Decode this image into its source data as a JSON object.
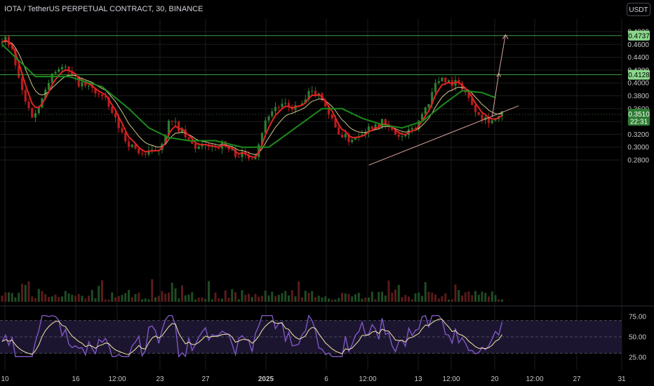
{
  "header": {
    "title": "IOTA / TetherUS PERPETUAL CONTRACT, 30, BINANCE",
    "currency_button": "USDT"
  },
  "colors": {
    "background": "#000000",
    "grid": "#1c1c1c",
    "axis_text": "#c8c8c8",
    "up_candle": "#2e7d32",
    "down_candle": "#b71c1c",
    "ema_red": "#e02424",
    "ema_yellow": "#f3e9a6",
    "ema_green": "#1b8a1b",
    "horizontal_level": "#3f9e3f",
    "label_green": "#8bd88b",
    "trendline": "#d8a49c",
    "rsi_band": "#1c1530",
    "rsi_line": "#7e57c2",
    "rsi_ma": "#f3e9a6"
  },
  "chart_data": {
    "type": "candlestick",
    "price_axis": {
      "ticks": [
        "0.4800",
        "0.4600",
        "0.4400",
        "0.4200",
        "0.4000",
        "0.3800",
        "0.3600",
        "0.3400",
        "0.3200",
        "0.3000",
        "0.2800"
      ],
      "range": [
        0.272,
        0.482
      ]
    },
    "time_axis": {
      "ticks": [
        "10",
        "16",
        "12:00",
        "23",
        "27",
        "2025",
        "6",
        "12:00",
        "13",
        "12:00",
        "20",
        "12:00",
        "27",
        "31"
      ]
    },
    "price_path": [
      [
        0,
        0.462
      ],
      [
        1,
        0.468
      ],
      [
        3,
        0.45
      ],
      [
        5,
        0.405
      ],
      [
        7,
        0.37
      ],
      [
        9,
        0.35
      ],
      [
        11,
        0.36
      ],
      [
        13,
        0.395
      ],
      [
        15,
        0.415
      ],
      [
        17,
        0.425
      ],
      [
        19,
        0.422
      ],
      [
        21,
        0.41
      ],
      [
        23,
        0.4
      ],
      [
        25,
        0.395
      ],
      [
        27,
        0.39
      ],
      [
        29,
        0.382
      ],
      [
        31,
        0.372
      ],
      [
        33,
        0.352
      ],
      [
        35,
        0.332
      ],
      [
        37,
        0.312
      ],
      [
        39,
        0.3
      ],
      [
        41,
        0.293
      ],
      [
        43,
        0.288
      ],
      [
        45,
        0.292
      ],
      [
        47,
        0.298
      ],
      [
        49,
        0.322
      ],
      [
        50,
        0.338
      ],
      [
        52,
        0.335
      ],
      [
        54,
        0.322
      ],
      [
        56,
        0.308
      ],
      [
        58,
        0.3
      ],
      [
        60,
        0.298
      ],
      [
        62,
        0.305
      ],
      [
        64,
        0.3
      ],
      [
        66,
        0.305
      ],
      [
        68,
        0.296
      ],
      [
        70,
        0.29
      ],
      [
        72,
        0.288
      ],
      [
        74,
        0.285
      ],
      [
        76,
        0.29
      ],
      [
        78,
        0.325
      ],
      [
        80,
        0.352
      ],
      [
        82,
        0.362
      ],
      [
        84,
        0.365
      ],
      [
        86,
        0.362
      ],
      [
        88,
        0.362
      ],
      [
        90,
        0.365
      ],
      [
        92,
        0.382
      ],
      [
        94,
        0.385
      ],
      [
        96,
        0.378
      ],
      [
        98,
        0.352
      ],
      [
        100,
        0.33
      ],
      [
        102,
        0.318
      ],
      [
        104,
        0.312
      ],
      [
        106,
        0.316
      ],
      [
        108,
        0.325
      ],
      [
        110,
        0.33
      ],
      [
        112,
        0.337
      ],
      [
        114,
        0.338
      ],
      [
        116,
        0.33
      ],
      [
        118,
        0.32
      ],
      [
        120,
        0.315
      ],
      [
        122,
        0.322
      ],
      [
        124,
        0.33
      ],
      [
        126,
        0.352
      ],
      [
        128,
        0.372
      ],
      [
        130,
        0.398
      ],
      [
        132,
        0.41
      ],
      [
        134,
        0.402
      ],
      [
        136,
        0.4
      ],
      [
        138,
        0.395
      ],
      [
        140,
        0.375
      ],
      [
        142,
        0.36
      ],
      [
        144,
        0.348
      ],
      [
        146,
        0.343
      ],
      [
        148,
        0.342
      ],
      [
        150,
        0.351
      ]
    ],
    "ema_green_path": [
      [
        0,
        0.46
      ],
      [
        10,
        0.41
      ],
      [
        20,
        0.41
      ],
      [
        30,
        0.394
      ],
      [
        38,
        0.36
      ],
      [
        44,
        0.33
      ],
      [
        50,
        0.315
      ],
      [
        56,
        0.31
      ],
      [
        64,
        0.31
      ],
      [
        72,
        0.3
      ],
      [
        80,
        0.3
      ],
      [
        88,
        0.33
      ],
      [
        96,
        0.36
      ],
      [
        102,
        0.36
      ],
      [
        108,
        0.345
      ],
      [
        114,
        0.335
      ],
      [
        120,
        0.33
      ],
      [
        126,
        0.34
      ],
      [
        132,
        0.365
      ],
      [
        138,
        0.388
      ],
      [
        144,
        0.385
      ],
      [
        148,
        0.377
      ]
    ],
    "horizontal_levels": [
      {
        "price": 0.4737,
        "label": "0.4737"
      },
      {
        "price": 0.4128,
        "label": "0.4128"
      }
    ],
    "last_price": {
      "price": 0.351,
      "label": "0.3510",
      "countdown": "22:31"
    },
    "trendline": {
      "from": [
        110,
        0.272
      ],
      "to": [
        155,
        0.3645
      ]
    },
    "projection": [
      [
        147,
        0.347
      ],
      [
        149,
        0.415
      ],
      [
        151,
        0.475
      ]
    ],
    "rsi": {
      "ticks": [
        "75.00",
        "50.00",
        "25.00"
      ],
      "range": [
        20,
        80
      ],
      "upper_band": 70,
      "lower_band": 30,
      "mid": 50
    }
  }
}
